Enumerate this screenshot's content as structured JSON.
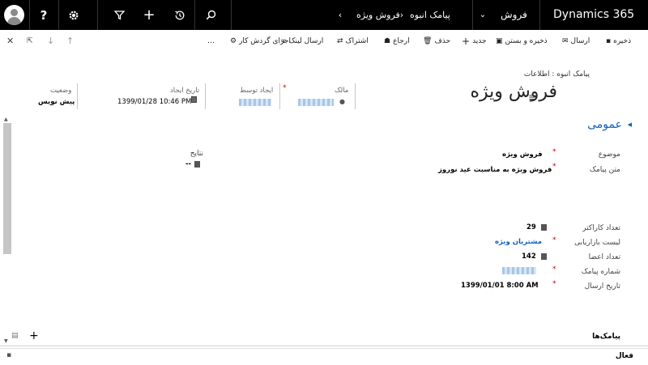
{
  "app_title": "Dynamics 365",
  "nav": {
    "area": "فروش",
    "entity": "پیامک انبوه",
    "record": "فروش ویژه"
  },
  "commands": {
    "save": "ذخیره",
    "send": "ارسال",
    "save_close": "ذخیره و بستن",
    "new": "جدید",
    "delete": "حذف",
    "assign": "ارجاع",
    "share": "اشتراک",
    "send_link": "ارسال لینک",
    "run_workflow": "اجرای گردش کار",
    "more": "…"
  },
  "form": {
    "breadcrumb": "پیامک انبوه : اطلاعات",
    "title": "فروش ویژه",
    "section_title": "عمومی"
  },
  "header_fields": {
    "owner_label": "مالک",
    "created_by_label": "ایجاد توسط",
    "created_on_label": "تاریخ ایجاد",
    "created_on_value": "1399/01/28  10:46 PM",
    "status_label": "وضعیت",
    "status_value": "پیش نویس"
  },
  "fields": {
    "subject_label": "موضوع",
    "subject_value": "فروش ویژه",
    "message_label": "متن پیامک",
    "message_value": "فروش ویژه به مناسبت عید نوروز",
    "result_label": "نتایج",
    "result_value": "--",
    "char_count_label": "تعداد کاراکتر",
    "char_count_value": "29",
    "marketing_list_label": "لیست بازاریابی",
    "marketing_list_value": "مشتریان ویژه",
    "member_count_label": "تعداد اعضا",
    "member_count_value": "142",
    "sms_number_label": "شماره پیامک",
    "send_date_label": "تاریخ ارسال",
    "send_date_value": "1399/01/01  8:00 AM"
  },
  "subgrid": {
    "title": "پیامک‌ها"
  },
  "footer": {
    "status": "فعال"
  },
  "colors": {
    "nav_bg": "#000000",
    "link": "#1160b7",
    "required": "#cc0000"
  }
}
